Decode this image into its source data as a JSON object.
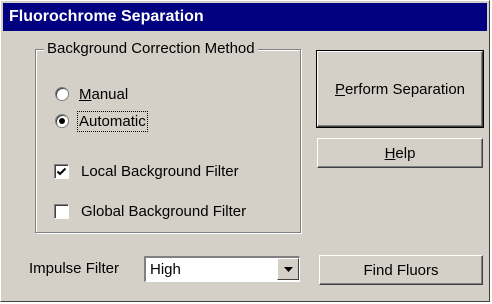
{
  "window": {
    "title": "Fluorochrome Separation"
  },
  "background_group": {
    "legend": "Background Correction Method",
    "options": [
      {
        "label": "Manual",
        "selected": false
      },
      {
        "label": "Automatic",
        "selected": true
      }
    ]
  },
  "filters": {
    "local": {
      "label": "Local Background Filter",
      "checked": true
    },
    "global": {
      "label": "Global Background Filter",
      "checked": false
    }
  },
  "buttons": {
    "perform": "Perform Separation",
    "help": "Help",
    "find_fluors": "Find Fluors"
  },
  "impulse": {
    "label": "Impulse Filter",
    "value": "High"
  },
  "colors": {
    "face": "#d4d0c8",
    "title_bg": "#000080",
    "title_fg": "#ffffff"
  },
  "icons": {
    "checkmark": "check-icon",
    "dropdown": "chevron-down-icon"
  }
}
